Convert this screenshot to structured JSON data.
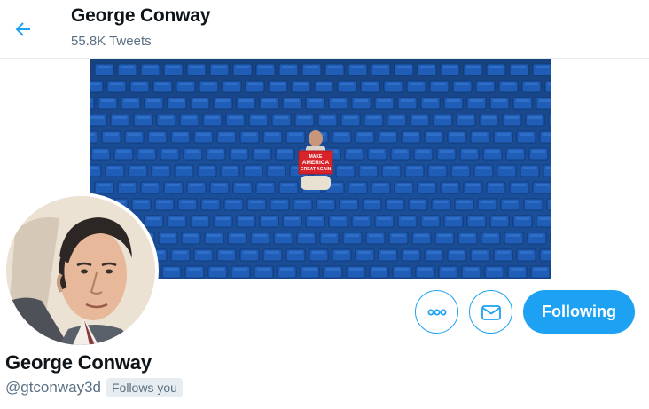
{
  "header": {
    "title": "George Conway",
    "tweet_count": "55.8K Tweets",
    "back_icon": "arrow-left-icon"
  },
  "banner": {
    "sign_lines": [
      "MAKE",
      "AMERICA",
      "GREAT AGAIN"
    ]
  },
  "profile": {
    "display_name": "George Conway",
    "handle": "@gtconway3d",
    "follows_you": "Follows you"
  },
  "actions": {
    "more_icon": "more-dots-icon",
    "message_icon": "mail-icon",
    "following_label": "Following"
  },
  "colors": {
    "accent": "#1da1f2",
    "secondary_text": "#5b7083",
    "badge_bg": "#e6ecf0",
    "seat_blue": "#1f5db6"
  }
}
